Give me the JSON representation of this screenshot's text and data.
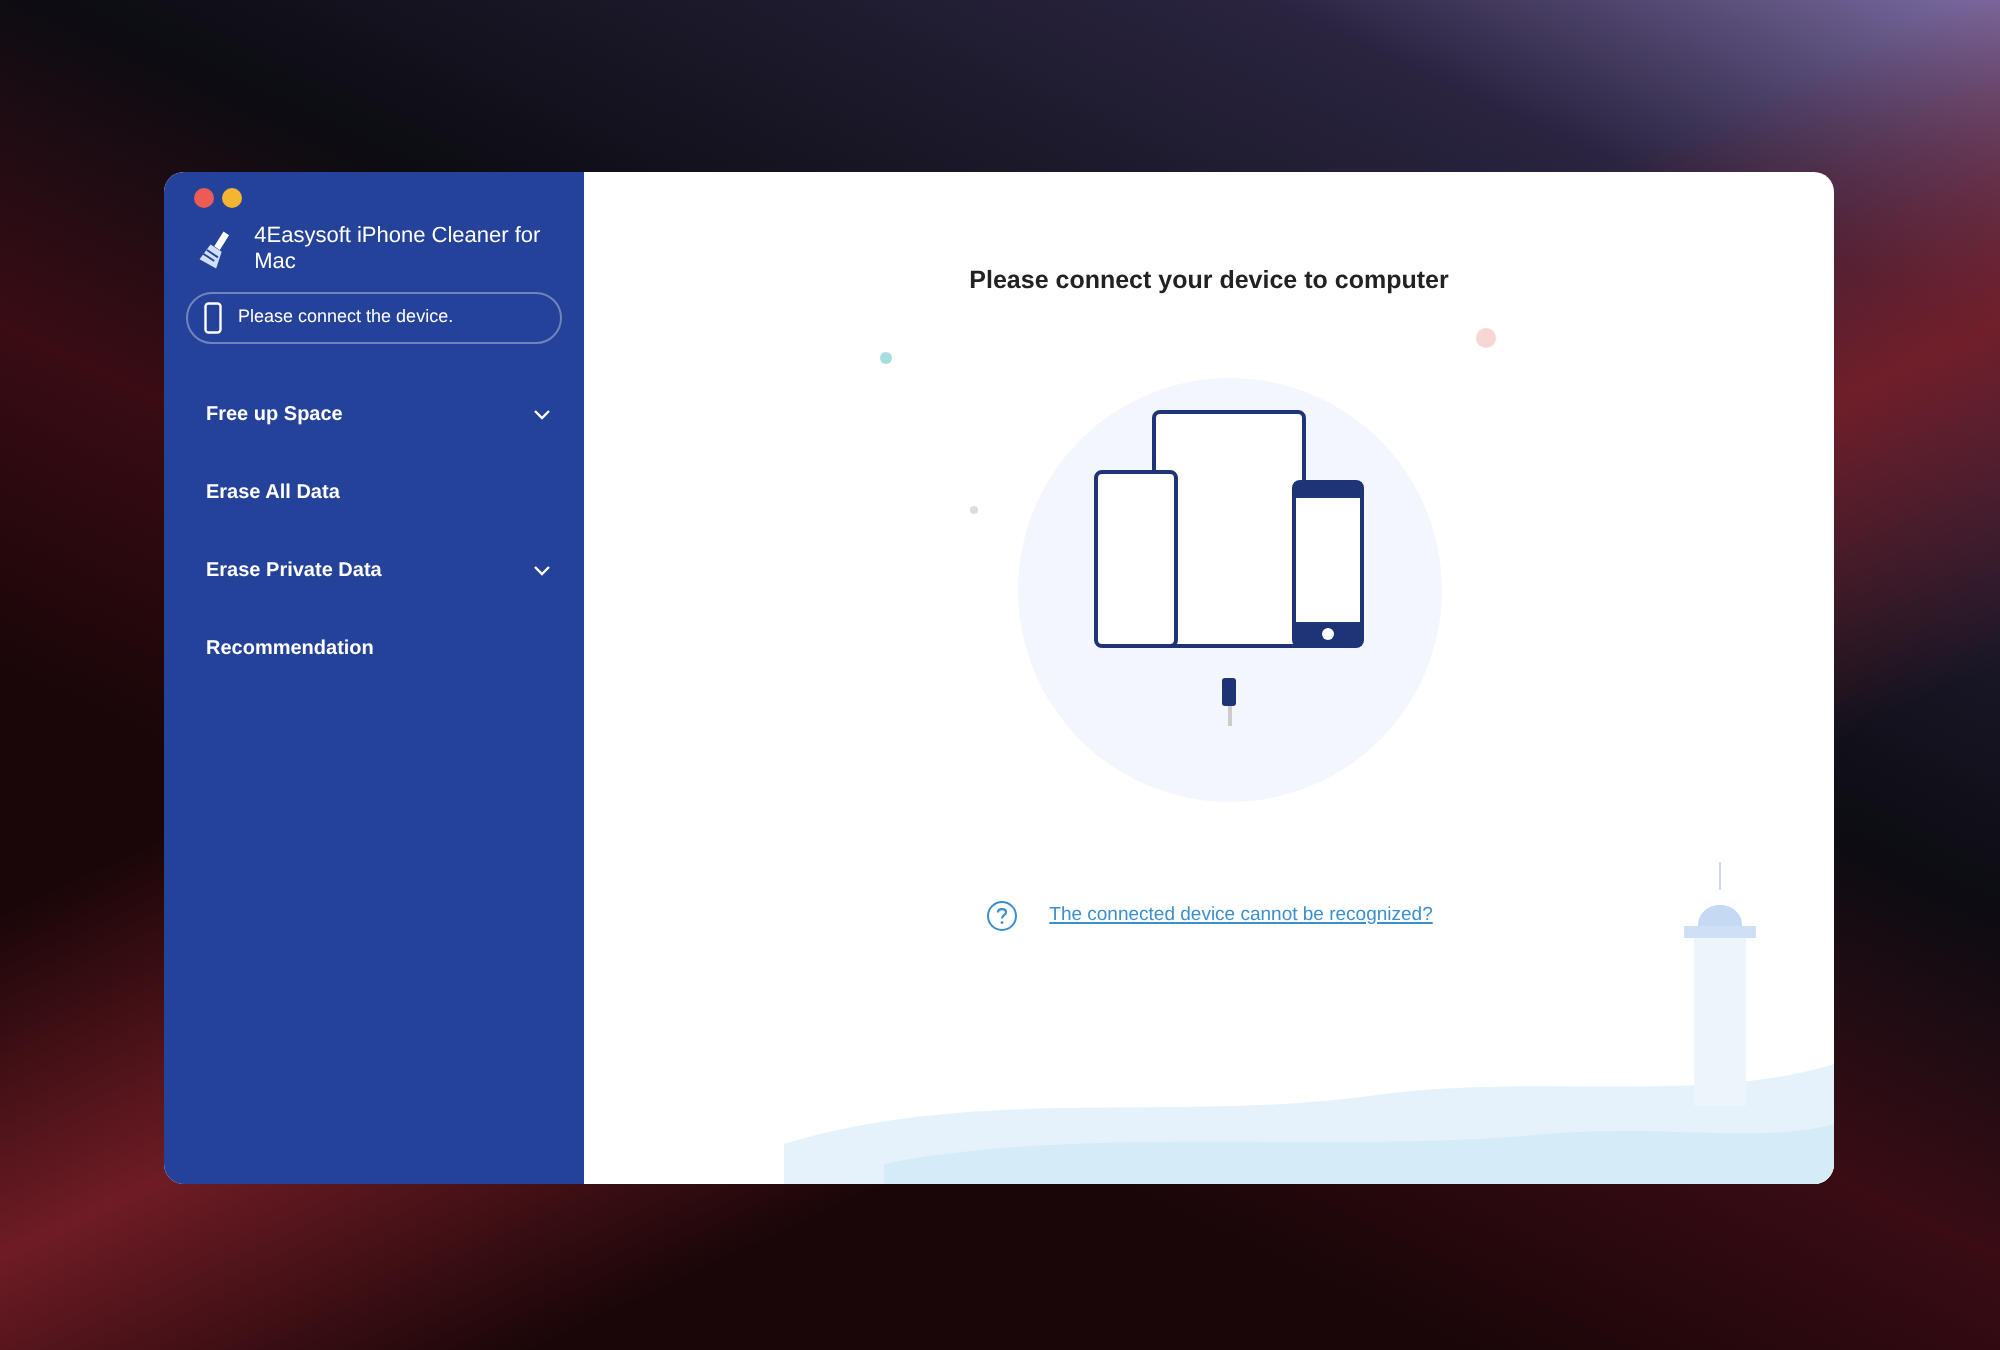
{
  "window": {
    "title": "4Easysoft iPhone Cleaner for Mac",
    "controls": [
      {
        "kind": "close"
      },
      {
        "kind": "minimize"
      }
    ]
  },
  "device_status": {
    "text": "Please connect the device."
  },
  "sidebar": {
    "items": [
      {
        "label": "Free up Space",
        "kind": "group"
      },
      {
        "label": "Erase All Data",
        "kind": "item"
      },
      {
        "label": "Erase Private Data",
        "kind": "group"
      },
      {
        "label": "Recommendation",
        "kind": "item"
      }
    ]
  },
  "main": {
    "heading": "Please connect your device to computer",
    "help_link": "The connected device cannot be recognized?"
  }
}
